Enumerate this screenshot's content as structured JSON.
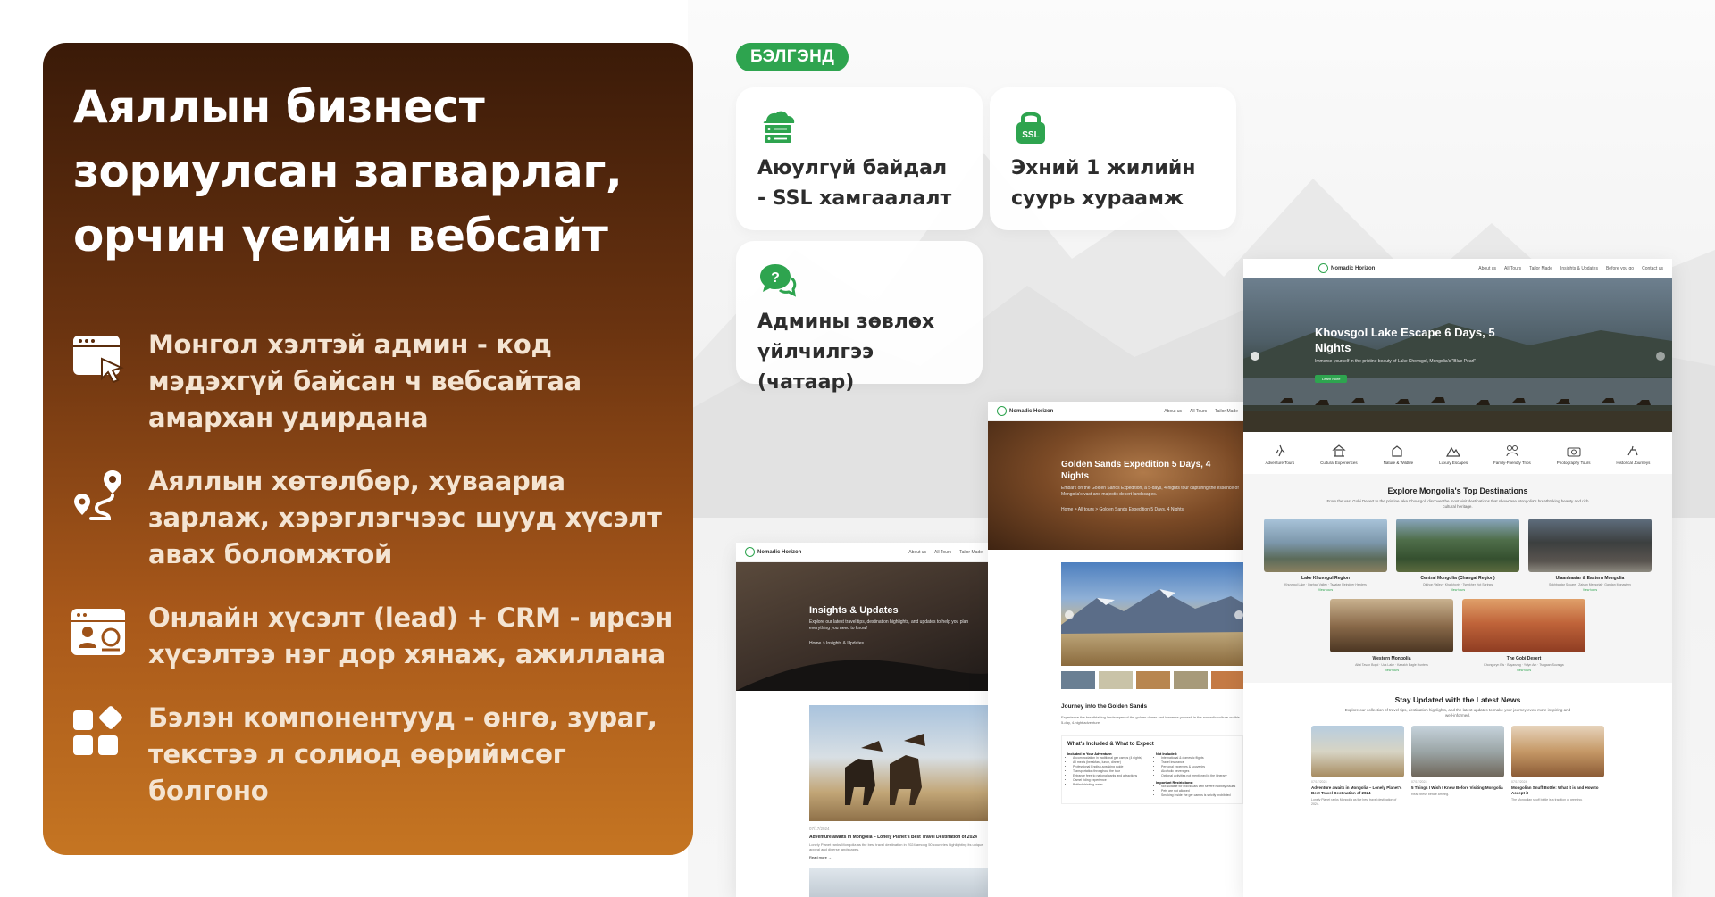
{
  "promo": {
    "title": "Аяллын бизнест зориулсан загварлаг, орчин үеийн вебсайт",
    "features": [
      {
        "icon": "browser-click-icon",
        "text": "Монгол хэлтэй админ - код мэдэхгүй байсан ч вебсайтаа амархан удирдана"
      },
      {
        "icon": "route-pin-icon",
        "text": "Аяллын хөтөлбөр, хуваариа зарлаж, хэрэглэгчээс шууд хүсэлт авах боломжтой"
      },
      {
        "icon": "crm-card-icon",
        "text": "Онлайн хүсэлт (lead) + CRM - ирсэн хүсэлтээ нэг дор хянаж, ажиллана"
      },
      {
        "icon": "components-icon",
        "text": "Бэлэн компонентууд - өнгө, зураг, текстээ л солиод өөриймсөг болгоно"
      }
    ]
  },
  "badge": "БЭЛГЭНД",
  "cards": [
    {
      "icon": "cloud-server-icon",
      "text": "Аюулгүй байдал - SSL хамгаалалт"
    },
    {
      "icon": "ssl-lock-icon",
      "text": "Эхний 1 жилийн суурь хураамж"
    },
    {
      "icon": "chat-help-icon",
      "text": "Админы зөвлөх үйлчилгээ (чатаар)"
    }
  ],
  "colors": {
    "accent": "#2ea44f",
    "panel_top": "#3a1a08",
    "panel_bottom": "#c57522"
  },
  "mock_main": {
    "brand": "Nomadic Horizon",
    "nav": [
      "About us",
      "All Tours",
      "Tailor Made",
      "Insights & Updates",
      "Before you go",
      "Contact us"
    ],
    "hero_title": "Khovsgol Lake Escape 6 Days, 5 Nights",
    "hero_sub": "Immerse yourself in the pristine beauty of Lake Khovsgol, Mongolia's \"Blue Pearl\"",
    "hero_button": "Learn more",
    "categories": [
      "Adventure Tours",
      "Cultural Experiences",
      "Nature & Wildlife",
      "Luxury Escapes",
      "Family-Friendly Trips",
      "Photography Tours",
      "Historical Journeys"
    ],
    "dest_title": "Explore Mongolia's Top Destinations",
    "dest_sub": "From the vast Gobi Desert to the pristine lake Khovsgol, discover the most visit destinations that showcase Mongolia's breathtaking beauty and rich cultural heritage.",
    "destinations": [
      {
        "name": "Lake Khuvsgul Region",
        "desc": "Khuvsgul Lake · Darhad Valley · Tsaatan Reindeer Herders",
        "link": "View tours"
      },
      {
        "name": "Central Mongolia (Changai Region)",
        "desc": "Orkhon Valley · Kharkhorin · Tsenkher Hot Springs",
        "link": "View tours"
      },
      {
        "name": "Ulaanbaatar & Eastern Mongolia",
        "desc": "Sukhbaatar Square · Zaisan Memorial · Gandan Monastery",
        "link": "View tours"
      },
      {
        "name": "Western Mongolia",
        "desc": "Altai Tavan Bogd · Uvs Lake · Kazakh Eagle Hunters",
        "link": "View tours"
      },
      {
        "name": "The Gobi Desert",
        "desc": "Khongoryn Els · Bayanzag · Yolyn Am · Tsagaan Suvarga",
        "link": "View tours"
      }
    ],
    "news_title": "Stay Updated with the Latest News",
    "news_sub": "Explore our collection of travel tips, destination highlights, and the latest updates to make your journey even more inspiring and well-informed.",
    "news": [
      {
        "date": "07/17/2024",
        "title": "Adventure awaits in Mongolia – Lonely Planet's Best Travel Destination of 2024",
        "text": "Lonely Planet ranks Mongolia as the best travel destination of 2024."
      },
      {
        "date": "07/17/2024",
        "title": "5 Things I Wish I Knew Before Visiting Mongolia",
        "text": "Read these before arriving."
      },
      {
        "date": "07/17/2024",
        "title": "Mongolian Snuff Bottle: What it is and How to Accept it",
        "text": "The Mongolian snuff bottle is a tradition of greeting."
      }
    ]
  },
  "mock_mid": {
    "brand": "Nomadic Horizon",
    "nav": [
      "About us",
      "All Tours",
      "Tailor Made"
    ],
    "hero_title": "Golden Sands Expedition 5 Days, 4 Nights",
    "hero_sub": "Embark on the Golden Sands Expedition, a 5-days, 4-nights tour capturing the essence of Mongolia's vast and majestic desert landscapes.",
    "crumb": "Home > All tours > Golden Sands Expedition 5 Days, 4 Nights",
    "section_title": "Journey into the Golden Sands",
    "section_text": "Experience the breathtaking landscapes of the golden dunes and immerse yourself in the nomadic culture on this 5-day, 4-night adventure.",
    "included_title": "What's Included & What to Expect",
    "included_label": "Included in Your Adventure:",
    "included": [
      "Accommodation in traditional ger camps (4 nights)",
      "All meals (breakfast, lunch, dinner)",
      "Professional English-speaking guide",
      "Transportation throughout the tour",
      "Entrance fees to national parks and attractions",
      "Camel riding experience",
      "Bottled drinking water"
    ],
    "not_label": "Not Included:",
    "not_included": [
      "International & domestic flights",
      "Travel insurance",
      "Personal expenses & souvenirs",
      "Alcoholic beverages",
      "Optional activities not mentioned in the itinerary"
    ],
    "notes_label": "Important Restrictions:",
    "notes": [
      "Not suitable for individuals with severe mobility issues",
      "Pets are not allowed",
      "Smoking inside the ger camps is strictly prohibited"
    ]
  },
  "mock_left": {
    "brand": "Nomadic Horizon",
    "nav": [
      "About us",
      "All Tours",
      "Tailor Made"
    ],
    "hero_title": "Insights & Updates",
    "hero_sub": "Explore our latest travel tips, destination highlights, and updates to help you plan everything you need to know!",
    "crumb": "Home > Insights & Updates",
    "post_meta": "07/17/2024",
    "post_title": "Adventure awaits in Mongolia – Lonely Planet's Best Travel Destination of 2024",
    "post_text": "Lonely Planet ranks Mongolia as the best travel destination in 2024 among 50 countries highlighting its unique appeal and diverse landscapes.",
    "read_more": "Read more →"
  }
}
